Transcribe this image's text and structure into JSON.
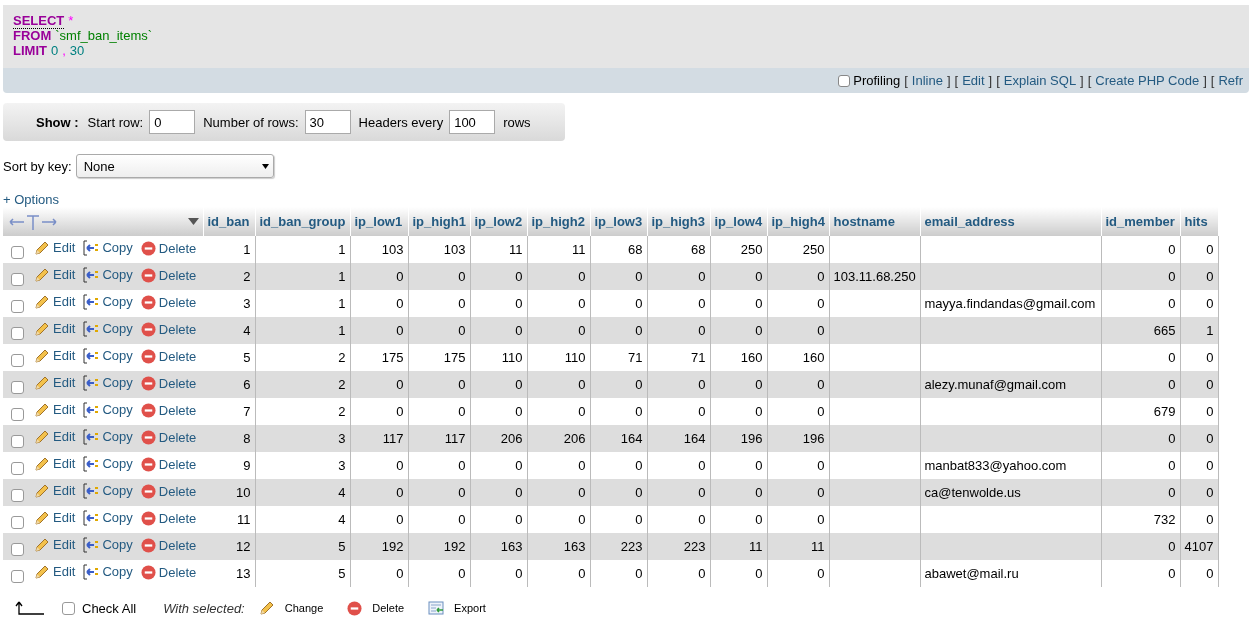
{
  "query": {
    "lines": [
      [
        {
          "kind": "keyword",
          "text": "SELECT"
        },
        {
          "kind": "operator",
          "text": "*"
        }
      ],
      [
        {
          "kind": "keyword",
          "text": "FROM"
        },
        {
          "kind": "identifier",
          "text": "`smf_ban_items`"
        }
      ],
      [
        {
          "kind": "keyword",
          "text": "LIMIT"
        },
        {
          "kind": "number",
          "text": "0"
        },
        {
          "kind": "operator",
          "text": ","
        },
        {
          "kind": "number",
          "text": "30"
        }
      ]
    ]
  },
  "query_bar": {
    "profiling": {
      "label": "Profiling",
      "checked": false
    },
    "items": [
      {
        "kind": "bracket",
        "text": "["
      },
      {
        "kind": "link",
        "text": "Inline"
      },
      {
        "kind": "bracket",
        "text": "]"
      },
      {
        "kind": "bracket",
        "text": "["
      },
      {
        "kind": "link",
        "text": "Edit"
      },
      {
        "kind": "bracket",
        "text": "]"
      },
      {
        "kind": "bracket",
        "text": "["
      },
      {
        "kind": "link",
        "text": "Explain SQL"
      },
      {
        "kind": "bracket",
        "text": "]"
      },
      {
        "kind": "bracket",
        "text": "["
      },
      {
        "kind": "link",
        "text": "Create PHP Code"
      },
      {
        "kind": "bracket",
        "text": "]"
      },
      {
        "kind": "bracket",
        "text": "["
      },
      {
        "kind": "link",
        "text": "Refr"
      }
    ]
  },
  "show_bar": {
    "title": "Show :",
    "start_row": {
      "label": "Start row:",
      "value": "0"
    },
    "number_of_rows": {
      "label": "Number of rows:",
      "value": "30"
    },
    "headers_every": {
      "label": "Headers every",
      "value": "100"
    },
    "suffix": "rows"
  },
  "sort": {
    "label": "Sort by key:",
    "value": "None"
  },
  "options_link": "+ Options",
  "table": {
    "columns": [
      "id_ban",
      "id_ban_group",
      "ip_low1",
      "ip_high1",
      "ip_low2",
      "ip_high2",
      "ip_low3",
      "ip_high3",
      "ip_low4",
      "ip_high4",
      "hostname",
      "email_address",
      "id_member",
      "hits"
    ],
    "rows": [
      {
        "checked": false,
        "actions": [
          "Edit",
          "Copy",
          "Delete"
        ],
        "cells": [
          "1",
          "1",
          "103",
          "103",
          "11",
          "11",
          "68",
          "68",
          "250",
          "250",
          null,
          null,
          "0",
          "0"
        ]
      },
      {
        "checked": false,
        "actions": [
          "Edit",
          "Copy",
          "Delete"
        ],
        "cells": [
          "2",
          "1",
          "0",
          "0",
          "0",
          "0",
          "0",
          "0",
          "0",
          "0",
          "103.11.68.250",
          null,
          "0",
          "0"
        ]
      },
      {
        "checked": false,
        "actions": [
          "Edit",
          "Copy",
          "Delete"
        ],
        "cells": [
          "3",
          "1",
          "0",
          "0",
          "0",
          "0",
          "0",
          "0",
          "0",
          "0",
          null,
          "mayya.findandas@gmail.com",
          "0",
          "0"
        ]
      },
      {
        "checked": false,
        "actions": [
          "Edit",
          "Copy",
          "Delete"
        ],
        "cells": [
          "4",
          "1",
          "0",
          "0",
          "0",
          "0",
          "0",
          "0",
          "0",
          "0",
          null,
          null,
          "665",
          "1"
        ]
      },
      {
        "checked": false,
        "actions": [
          "Edit",
          "Copy",
          "Delete"
        ],
        "cells": [
          "5",
          "2",
          "175",
          "175",
          "110",
          "110",
          "71",
          "71",
          "160",
          "160",
          null,
          null,
          "0",
          "0"
        ]
      },
      {
        "checked": false,
        "actions": [
          "Edit",
          "Copy",
          "Delete"
        ],
        "cells": [
          "6",
          "2",
          "0",
          "0",
          "0",
          "0",
          "0",
          "0",
          "0",
          "0",
          null,
          "alezy.munaf@gmail.com",
          "0",
          "0"
        ]
      },
      {
        "checked": false,
        "actions": [
          "Edit",
          "Copy",
          "Delete"
        ],
        "cells": [
          "7",
          "2",
          "0",
          "0",
          "0",
          "0",
          "0",
          "0",
          "0",
          "0",
          null,
          null,
          "679",
          "0"
        ]
      },
      {
        "checked": false,
        "actions": [
          "Edit",
          "Copy",
          "Delete"
        ],
        "cells": [
          "8",
          "3",
          "117",
          "117",
          "206",
          "206",
          "164",
          "164",
          "196",
          "196",
          null,
          null,
          "0",
          "0"
        ]
      },
      {
        "checked": false,
        "actions": [
          "Edit",
          "Copy",
          "Delete"
        ],
        "cells": [
          "9",
          "3",
          "0",
          "0",
          "0",
          "0",
          "0",
          "0",
          "0",
          "0",
          null,
          "manbat833@yahoo.com",
          "0",
          "0"
        ]
      },
      {
        "checked": false,
        "actions": [
          "Edit",
          "Copy",
          "Delete"
        ],
        "cells": [
          "10",
          "4",
          "0",
          "0",
          "0",
          "0",
          "0",
          "0",
          "0",
          "0",
          null,
          "ca@tenwolde.us",
          "0",
          "0"
        ]
      },
      {
        "checked": false,
        "actions": [
          "Edit",
          "Copy",
          "Delete"
        ],
        "cells": [
          "11",
          "4",
          "0",
          "0",
          "0",
          "0",
          "0",
          "0",
          "0",
          "0",
          null,
          null,
          "732",
          "0"
        ]
      },
      {
        "checked": false,
        "actions": [
          "Edit",
          "Copy",
          "Delete"
        ],
        "cells": [
          "12",
          "5",
          "192",
          "192",
          "163",
          "163",
          "223",
          "223",
          "11",
          "11",
          null,
          null,
          "0",
          "4107"
        ]
      },
      {
        "checked": false,
        "actions": [
          "Edit",
          "Copy",
          "Delete"
        ],
        "cells": [
          "13",
          "5",
          "0",
          "0",
          "0",
          "0",
          "0",
          "0",
          "0",
          "0",
          null,
          "abawet@mail.ru",
          "0",
          "0"
        ]
      }
    ]
  },
  "footer": {
    "check_all": {
      "label": "Check All",
      "checked": false
    },
    "with_selected": "With selected:",
    "actions": [
      {
        "kind": "change",
        "label": "Change"
      },
      {
        "kind": "delete",
        "label": "Delete"
      },
      {
        "kind": "export",
        "label": "Export"
      }
    ]
  }
}
